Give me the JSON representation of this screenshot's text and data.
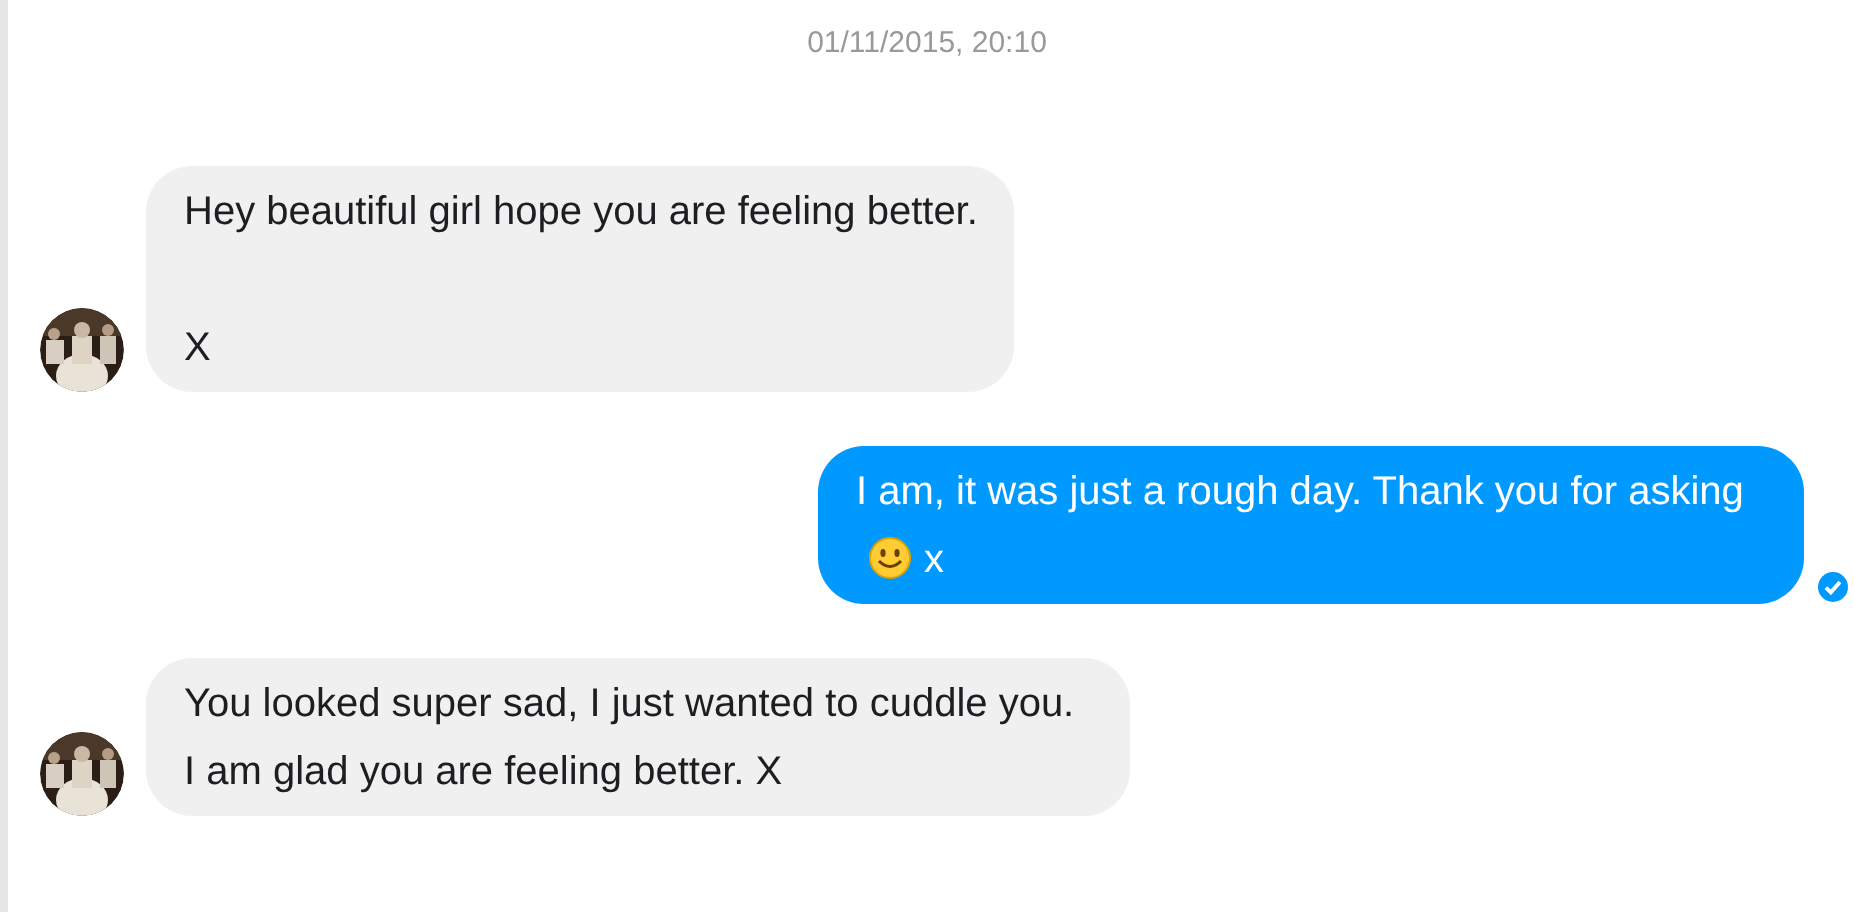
{
  "timestamp": "01/11/2015, 20:10",
  "messages": [
    {
      "kind": "incoming",
      "paragraphs": [
        "Hey beautiful girl hope you are feeling better.",
        "X"
      ]
    },
    {
      "kind": "outgoing",
      "seen": true,
      "parts": [
        {
          "kind": "text",
          "text": "I am, it was just a rough day. Thank you for asking"
        },
        {
          "kind": "smiley"
        },
        {
          "kind": "text",
          "text": "x"
        }
      ]
    },
    {
      "kind": "incoming",
      "paragraphs": [
        "You looked super sad, I just wanted to cuddle you. I am glad you are feeling better. X"
      ]
    }
  ]
}
